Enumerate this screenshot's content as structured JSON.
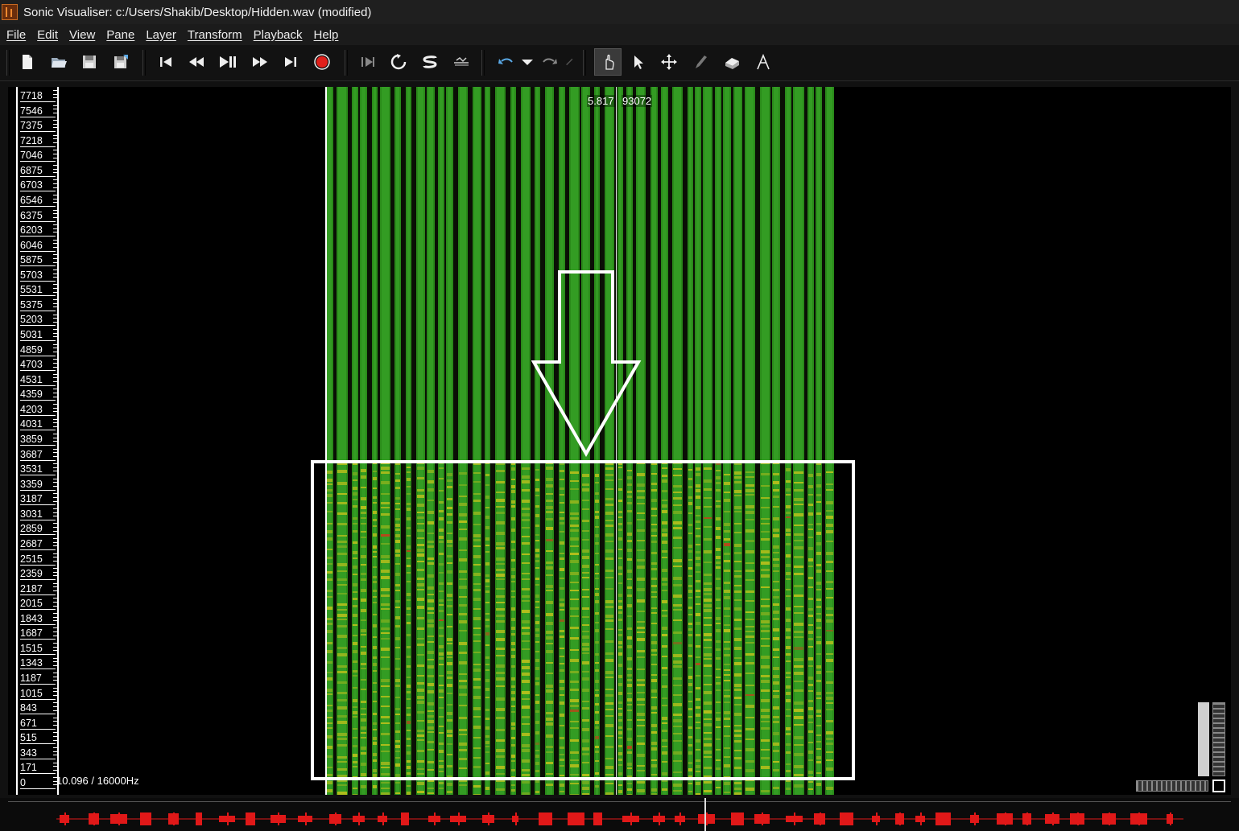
{
  "window": {
    "title": "Sonic Visualiser: c:/Users/Shakib/Desktop/Hidden.wav (modified)"
  },
  "menu": [
    "File",
    "Edit",
    "View",
    "Pane",
    "Layer",
    "Transform",
    "Playback",
    "Help"
  ],
  "toolbar": {
    "file_buttons": [
      "new-file-icon",
      "open-file-icon",
      "save-file-icon",
      "save-as-icon"
    ],
    "transport_buttons": [
      "rewind-start-icon",
      "rewind-icon",
      "play-pause-icon",
      "fast-forward-icon",
      "fast-forward-end-icon",
      "record-icon"
    ],
    "play_mode_buttons": [
      "play-selection-icon",
      "loop-icon",
      "solo-icon",
      "speed-icon"
    ],
    "edit_buttons": [
      "undo-icon",
      "undo-menu-icon",
      "redo-icon",
      "redo-menu-icon"
    ],
    "tool_buttons": [
      "navigate-tool-icon",
      "select-tool-icon",
      "move-tool-icon",
      "draw-tool-icon",
      "erase-tool-icon",
      "measure-tool-icon"
    ],
    "active_tool": "navigate",
    "record_color": "#e0201b",
    "undo_color": "#5aa9e6"
  },
  "pane": {
    "frequency_labels": [
      "7718",
      "7546",
      "7375",
      "7218",
      "7046",
      "6875",
      "6703",
      "6546",
      "6375",
      "6203",
      "6046",
      "5875",
      "5703",
      "5531",
      "5375",
      "5203",
      "5031",
      "4859",
      "4703",
      "4531",
      "4359",
      "4203",
      "4031",
      "3859",
      "3687",
      "3531",
      "3359",
      "3187",
      "3031",
      "2859",
      "2687",
      "2515",
      "2359",
      "2187",
      "2015",
      "1843",
      "1687",
      "1515",
      "1343",
      "1187",
      "1015",
      "843",
      "671",
      "515",
      "343",
      "171",
      "0"
    ],
    "cursor_time": "5.817",
    "cursor_frame": "93072",
    "info_label": "10.096 / 16000Hz",
    "spectrogram_colors": {
      "dark": "#0a0f05",
      "green": "#2a8a1a",
      "bright": "#3aa82a",
      "yellow": "#c8c41a",
      "red": "#d03818"
    },
    "annotation_color": "#ffffff"
  },
  "overview": {
    "waveform_color": "#e01818"
  }
}
